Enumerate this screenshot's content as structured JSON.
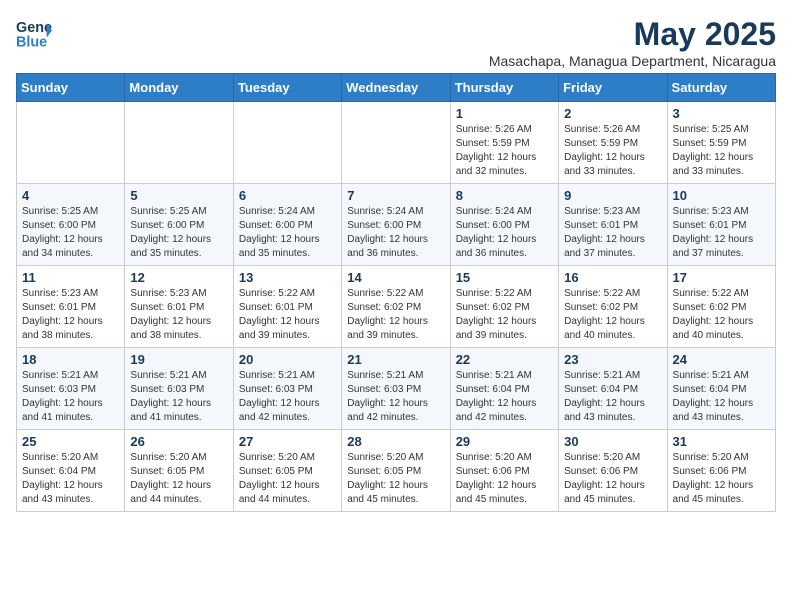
{
  "header": {
    "logo_general": "General",
    "logo_blue": "Blue",
    "month": "May 2025",
    "location": "Masachapa, Managua Department, Nicaragua"
  },
  "weekdays": [
    "Sunday",
    "Monday",
    "Tuesday",
    "Wednesday",
    "Thursday",
    "Friday",
    "Saturday"
  ],
  "weeks": [
    [
      {
        "day": "",
        "info": ""
      },
      {
        "day": "",
        "info": ""
      },
      {
        "day": "",
        "info": ""
      },
      {
        "day": "",
        "info": ""
      },
      {
        "day": "1",
        "info": "Sunrise: 5:26 AM\nSunset: 5:59 PM\nDaylight: 12 hours\nand 32 minutes."
      },
      {
        "day": "2",
        "info": "Sunrise: 5:26 AM\nSunset: 5:59 PM\nDaylight: 12 hours\nand 33 minutes."
      },
      {
        "day": "3",
        "info": "Sunrise: 5:25 AM\nSunset: 5:59 PM\nDaylight: 12 hours\nand 33 minutes."
      }
    ],
    [
      {
        "day": "4",
        "info": "Sunrise: 5:25 AM\nSunset: 6:00 PM\nDaylight: 12 hours\nand 34 minutes."
      },
      {
        "day": "5",
        "info": "Sunrise: 5:25 AM\nSunset: 6:00 PM\nDaylight: 12 hours\nand 35 minutes."
      },
      {
        "day": "6",
        "info": "Sunrise: 5:24 AM\nSunset: 6:00 PM\nDaylight: 12 hours\nand 35 minutes."
      },
      {
        "day": "7",
        "info": "Sunrise: 5:24 AM\nSunset: 6:00 PM\nDaylight: 12 hours\nand 36 minutes."
      },
      {
        "day": "8",
        "info": "Sunrise: 5:24 AM\nSunset: 6:00 PM\nDaylight: 12 hours\nand 36 minutes."
      },
      {
        "day": "9",
        "info": "Sunrise: 5:23 AM\nSunset: 6:01 PM\nDaylight: 12 hours\nand 37 minutes."
      },
      {
        "day": "10",
        "info": "Sunrise: 5:23 AM\nSunset: 6:01 PM\nDaylight: 12 hours\nand 37 minutes."
      }
    ],
    [
      {
        "day": "11",
        "info": "Sunrise: 5:23 AM\nSunset: 6:01 PM\nDaylight: 12 hours\nand 38 minutes."
      },
      {
        "day": "12",
        "info": "Sunrise: 5:23 AM\nSunset: 6:01 PM\nDaylight: 12 hours\nand 38 minutes."
      },
      {
        "day": "13",
        "info": "Sunrise: 5:22 AM\nSunset: 6:01 PM\nDaylight: 12 hours\nand 39 minutes."
      },
      {
        "day": "14",
        "info": "Sunrise: 5:22 AM\nSunset: 6:02 PM\nDaylight: 12 hours\nand 39 minutes."
      },
      {
        "day": "15",
        "info": "Sunrise: 5:22 AM\nSunset: 6:02 PM\nDaylight: 12 hours\nand 39 minutes."
      },
      {
        "day": "16",
        "info": "Sunrise: 5:22 AM\nSunset: 6:02 PM\nDaylight: 12 hours\nand 40 minutes."
      },
      {
        "day": "17",
        "info": "Sunrise: 5:22 AM\nSunset: 6:02 PM\nDaylight: 12 hours\nand 40 minutes."
      }
    ],
    [
      {
        "day": "18",
        "info": "Sunrise: 5:21 AM\nSunset: 6:03 PM\nDaylight: 12 hours\nand 41 minutes."
      },
      {
        "day": "19",
        "info": "Sunrise: 5:21 AM\nSunset: 6:03 PM\nDaylight: 12 hours\nand 41 minutes."
      },
      {
        "day": "20",
        "info": "Sunrise: 5:21 AM\nSunset: 6:03 PM\nDaylight: 12 hours\nand 42 minutes."
      },
      {
        "day": "21",
        "info": "Sunrise: 5:21 AM\nSunset: 6:03 PM\nDaylight: 12 hours\nand 42 minutes."
      },
      {
        "day": "22",
        "info": "Sunrise: 5:21 AM\nSunset: 6:04 PM\nDaylight: 12 hours\nand 42 minutes."
      },
      {
        "day": "23",
        "info": "Sunrise: 5:21 AM\nSunset: 6:04 PM\nDaylight: 12 hours\nand 43 minutes."
      },
      {
        "day": "24",
        "info": "Sunrise: 5:21 AM\nSunset: 6:04 PM\nDaylight: 12 hours\nand 43 minutes."
      }
    ],
    [
      {
        "day": "25",
        "info": "Sunrise: 5:20 AM\nSunset: 6:04 PM\nDaylight: 12 hours\nand 43 minutes."
      },
      {
        "day": "26",
        "info": "Sunrise: 5:20 AM\nSunset: 6:05 PM\nDaylight: 12 hours\nand 44 minutes."
      },
      {
        "day": "27",
        "info": "Sunrise: 5:20 AM\nSunset: 6:05 PM\nDaylight: 12 hours\nand 44 minutes."
      },
      {
        "day": "28",
        "info": "Sunrise: 5:20 AM\nSunset: 6:05 PM\nDaylight: 12 hours\nand 45 minutes."
      },
      {
        "day": "29",
        "info": "Sunrise: 5:20 AM\nSunset: 6:06 PM\nDaylight: 12 hours\nand 45 minutes."
      },
      {
        "day": "30",
        "info": "Sunrise: 5:20 AM\nSunset: 6:06 PM\nDaylight: 12 hours\nand 45 minutes."
      },
      {
        "day": "31",
        "info": "Sunrise: 5:20 AM\nSunset: 6:06 PM\nDaylight: 12 hours\nand 45 minutes."
      }
    ]
  ]
}
